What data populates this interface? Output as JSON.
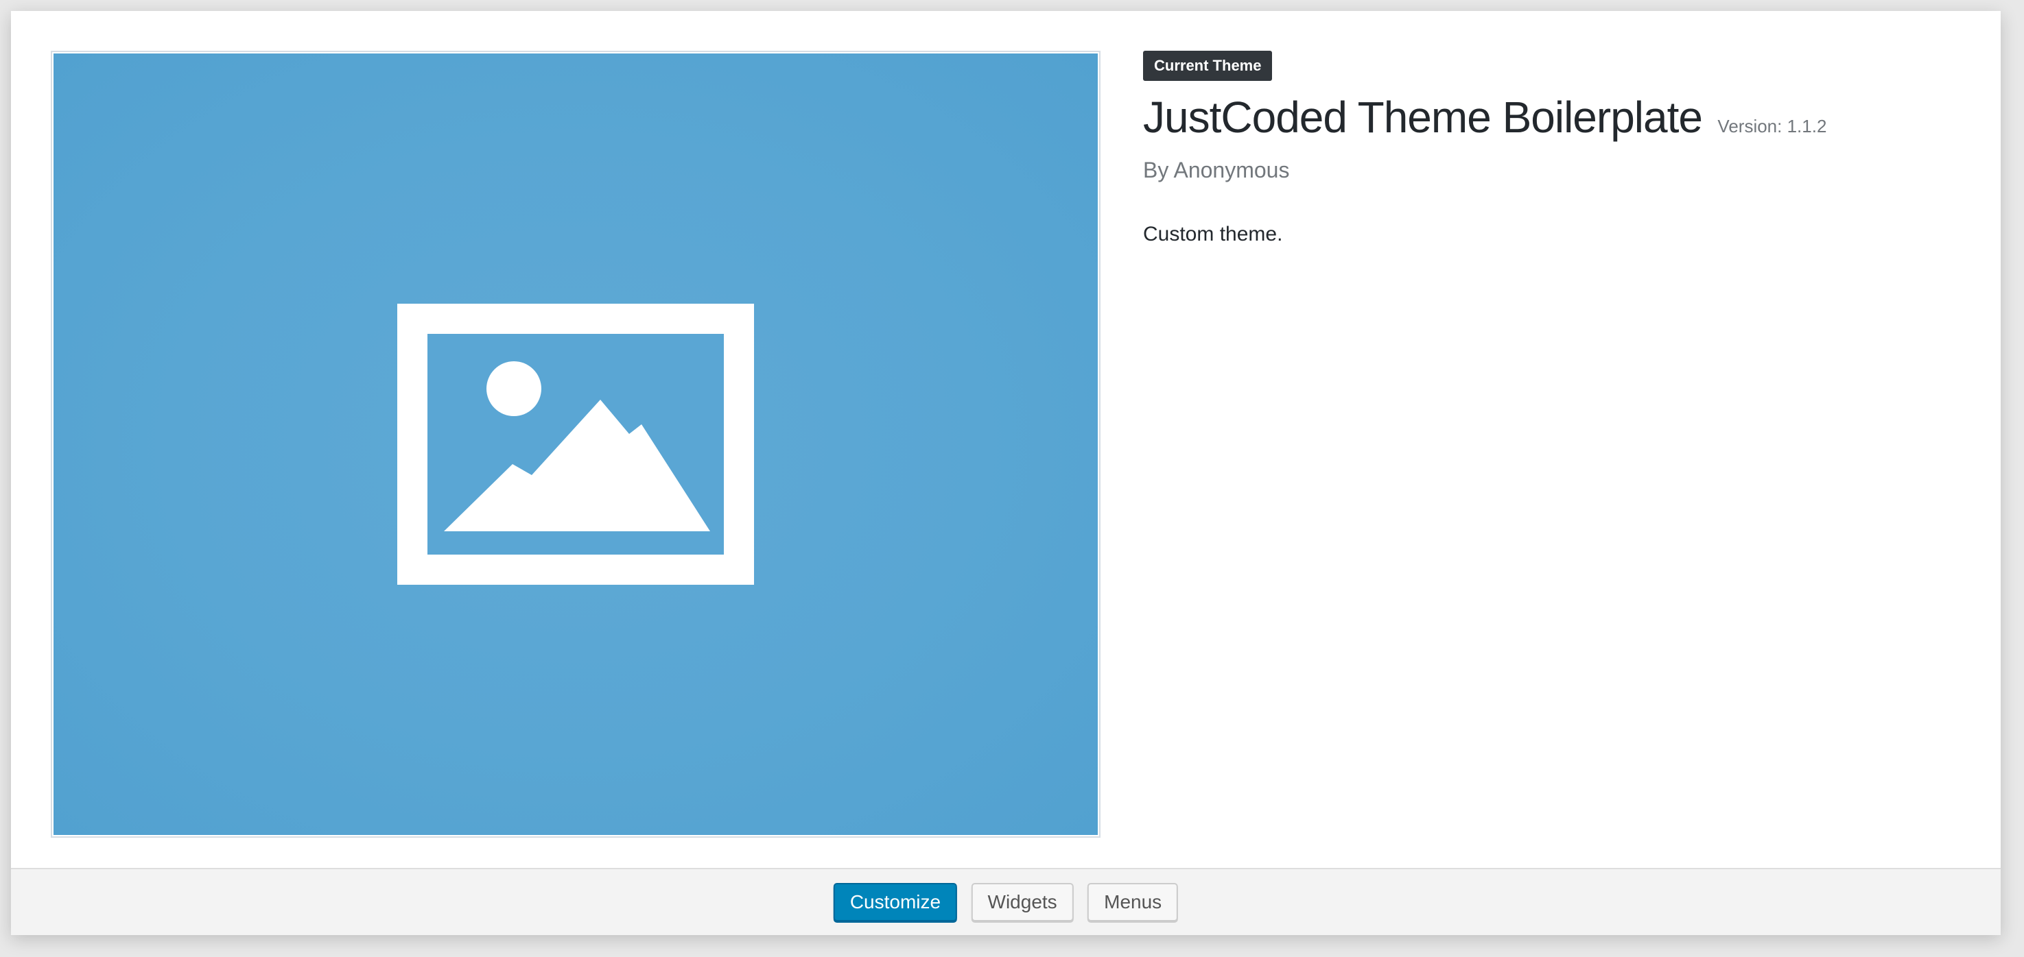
{
  "theme": {
    "current_label": "Current Theme",
    "name": "JustCoded Theme Boilerplate",
    "version": "Version: 1.1.2",
    "author": "By Anonymous",
    "description": "Custom theme."
  },
  "screenshot": {
    "icon": "image-placeholder-icon",
    "background_color": "#5aa6d4"
  },
  "actions": {
    "customize_label": "Customize",
    "widgets_label": "Widgets",
    "menus_label": "Menus"
  },
  "colors": {
    "primary_button": "#0085ba",
    "label_badge": "#32373c"
  }
}
